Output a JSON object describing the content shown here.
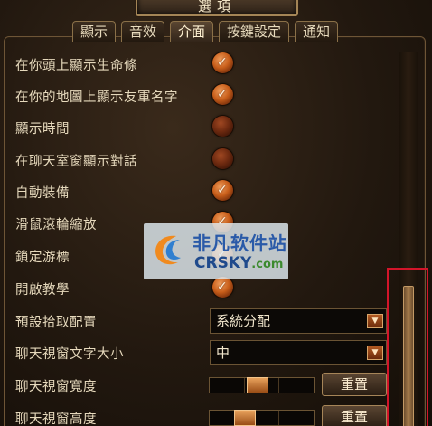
{
  "window": {
    "title": "選項"
  },
  "tabs": [
    {
      "label": "顯示",
      "active": false
    },
    {
      "label": "音效",
      "active": false
    },
    {
      "label": "介面",
      "active": true
    },
    {
      "label": "按鍵設定",
      "active": false
    },
    {
      "label": "通知",
      "active": false
    }
  ],
  "settings": {
    "show_hp_bar": {
      "label": "在你頭上顯示生命條",
      "checked": true
    },
    "show_ally_names": {
      "label": "在你的地圖上顯示友軍名字",
      "checked": true
    },
    "show_time": {
      "label": "顯示時間",
      "checked": false
    },
    "show_chat_bubbles": {
      "label": "在聊天室窗顯示對話",
      "checked": false
    },
    "auto_equip": {
      "label": "自動裝備",
      "checked": true
    },
    "wheel_zoom": {
      "label": "滑鼠滾輪縮放",
      "checked": true
    },
    "lock_cursor": {
      "label": "鎖定游標",
      "checked": true
    },
    "tutorial": {
      "label": "開啟教學",
      "checked": true
    },
    "loot_config": {
      "label": "預設拾取配置",
      "value": "系統分配"
    },
    "chat_font_size": {
      "label": "聊天視窗文字大小",
      "value": "中"
    },
    "chat_width": {
      "label": "聊天視窗寬度",
      "level": 0.45,
      "reset_label": "重置"
    },
    "chat_height": {
      "label": "聊天視窗高度",
      "level": 0.3,
      "reset_label": "重置"
    }
  },
  "watermark": {
    "brand": "非凡软件站",
    "site": "CRSKY",
    "domain": ".com"
  },
  "colors": {
    "accent": "#c85e1a",
    "highlight_box": "#d3152a"
  }
}
